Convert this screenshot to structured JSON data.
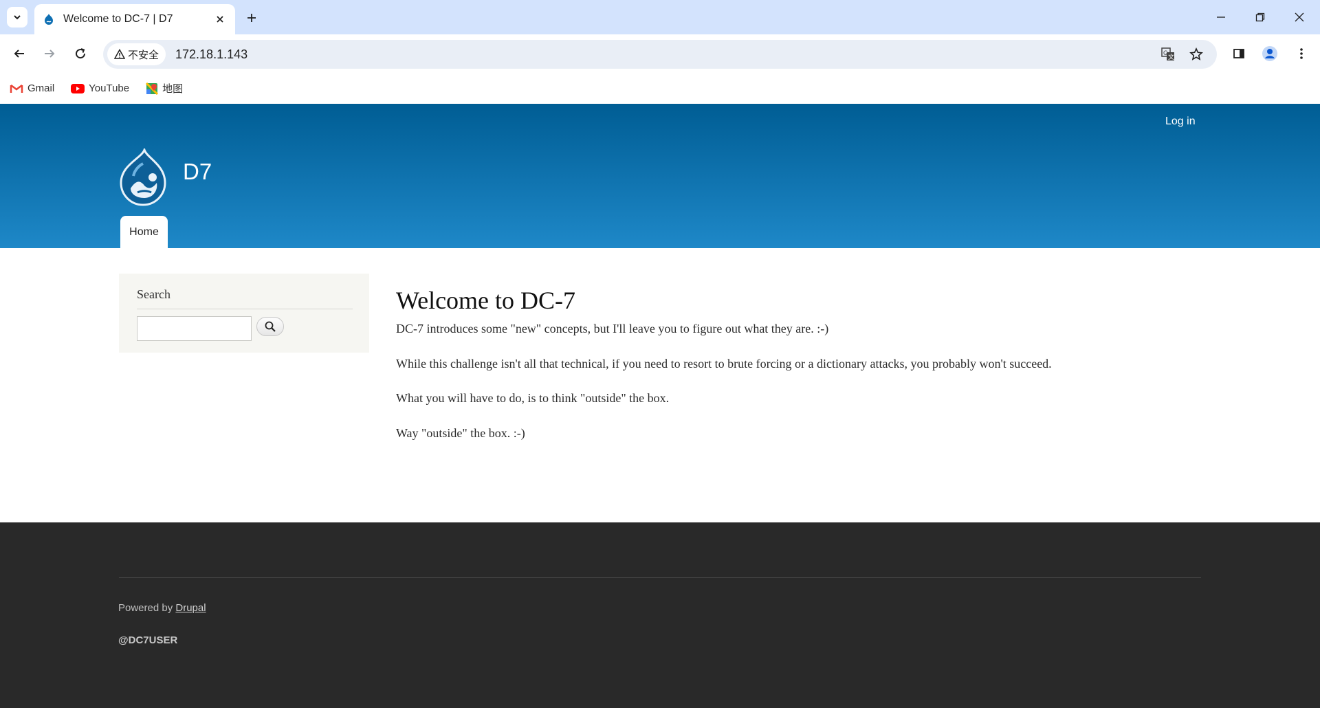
{
  "browser": {
    "tab_title": "Welcome to DC-7 | D7",
    "security_label": "不安全",
    "url": "172.18.1.143",
    "bookmarks": [
      "Gmail",
      "YouTube",
      "地图"
    ]
  },
  "header": {
    "login_label": "Log in",
    "site_name": "D7",
    "nav": [
      "Home"
    ]
  },
  "sidebar": {
    "search_title": "Search"
  },
  "main": {
    "title": "Welcome to DC-7",
    "paragraphs": [
      "DC-7 introduces some \"new\" concepts, but I'll leave you to figure out what they are.  :-)",
      "While this challenge isn't all that technical, if you need to resort to brute forcing or a dictionary attacks, you probably won't succeed.",
      "What you will have to do, is to think \"outside\" the box.",
      "Way \"outside\" the box.  :-)"
    ]
  },
  "footer": {
    "powered_prefix": "Powered by",
    "powered_link": "Drupal",
    "handle": "@DC7USER"
  },
  "colors": {
    "header_top": "#005d94",
    "header_bottom": "#1e88c8",
    "footer_bg": "#292929",
    "tabstrip_bg": "#d3e3fd"
  }
}
